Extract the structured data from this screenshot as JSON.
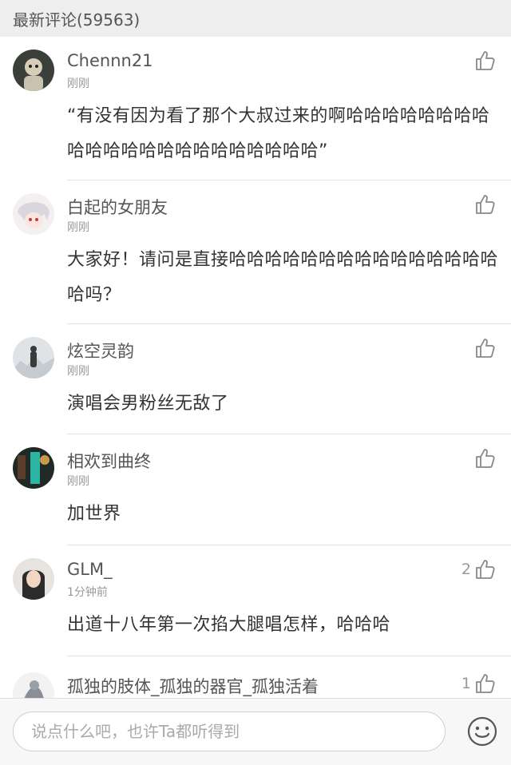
{
  "header": {
    "title": "最新评论(59563)"
  },
  "comments": [
    {
      "avatar_icon": "user-avatar-icon",
      "username": "Chennn21",
      "time": "刚刚",
      "likes": "",
      "text": "“有没有因为看了那个大叔过来的啊哈哈哈哈哈哈哈哈哈哈哈哈哈哈哈哈哈哈哈哈哈哈”"
    },
    {
      "avatar_icon": "user-avatar-icon",
      "username": "白起的女朋友",
      "time": "刚刚",
      "likes": "",
      "text": "大家好！请问是直接哈哈哈哈哈哈哈哈哈哈哈哈哈哈哈哈吗？"
    },
    {
      "avatar_icon": "user-avatar-icon",
      "username": "炫空灵韵",
      "time": "刚刚",
      "likes": "",
      "text": "演唱会男粉丝无敌了"
    },
    {
      "avatar_icon": "user-avatar-icon",
      "username": "相欢到曲终",
      "time": "刚刚",
      "likes": "",
      "text": "加世界"
    },
    {
      "avatar_icon": "user-avatar-icon",
      "username": "GLM_",
      "time": "1分钟前",
      "likes": "2",
      "text": "出道十八年第一次掐大腿唱怎样，哈哈哈"
    },
    {
      "avatar_icon": "user-avatar-icon",
      "username": "孤独的肢体_孤独的器官_孤独活着",
      "time": "",
      "likes": "1",
      "text": ""
    }
  ],
  "like_icon": "thumbs-up-icon",
  "input": {
    "placeholder": "说点什么吧，也许Ta都听得到"
  },
  "emoji_icon": "smiley-face-icon",
  "colors": {
    "header_bg": "#eeeeee",
    "text_main": "#333333",
    "text_muted": "#999999",
    "divider": "#e2e2e2"
  }
}
